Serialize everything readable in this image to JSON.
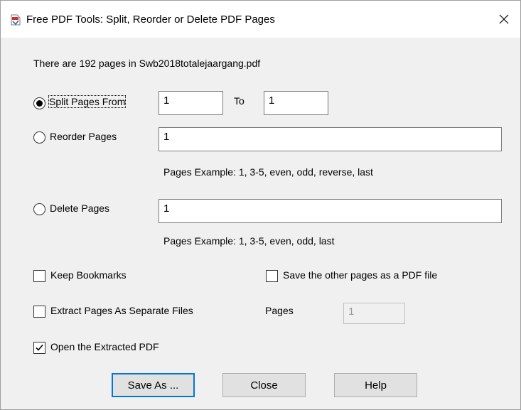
{
  "window": {
    "title": "Free PDF Tools: Split, Reorder or Delete PDF Pages"
  },
  "info": {
    "pages_text": "There are 192 pages in Swb2018totalejaargang.pdf"
  },
  "split": {
    "label": "Split Pages From",
    "from_value": "1",
    "to_label": "To",
    "to_value": "1",
    "selected": true
  },
  "reorder": {
    "label": "Reorder Pages",
    "value": "1",
    "example": "Pages Example: 1, 3-5, even, odd, reverse, last",
    "selected": false
  },
  "delete": {
    "label": "Delete Pages",
    "value": "1",
    "example": "Pages Example: 1, 3-5, even, odd, last",
    "selected": false
  },
  "options": {
    "keep_bookmarks": {
      "label": "Keep Bookmarks",
      "checked": false
    },
    "save_other": {
      "label": "Save the other pages as a PDF file",
      "checked": false
    },
    "extract_separate": {
      "label": "Extract Pages As Separate Files",
      "checked": false
    },
    "pages_label": "Pages",
    "pages_value": "1",
    "open_extracted": {
      "label": "Open the Extracted PDF",
      "checked": true
    }
  },
  "buttons": {
    "save_as": "Save As ...",
    "close": "Close",
    "help": "Help"
  },
  "icons": {
    "app": "pdf-document-icon",
    "close": "close-icon",
    "check": "checkmark-icon"
  },
  "colors": {
    "default_button_border": "#0078d7",
    "pdf_red": "#d32f2f"
  }
}
